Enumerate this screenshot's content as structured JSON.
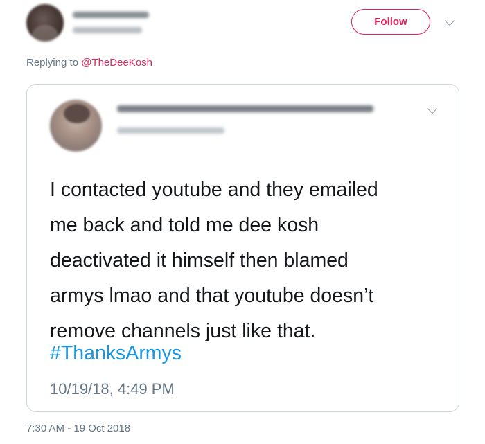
{
  "outer_tweet": {
    "follow_label": "Follow",
    "replying_prefix": "Replying to",
    "replying_mention": "@TheDeeKosh",
    "timestamp": "7:30 AM - 19 Oct 2018"
  },
  "quoted_tweet": {
    "text_lines": [
      "I contacted youtube and they emailed",
      "me back and told me dee kosh",
      "deactivated it himself then blamed",
      "armys lmao and that youtube doesn’t",
      "remove channels just like that."
    ],
    "hashtag": "#ThanksArmys",
    "timestamp": "10/19/18, 4:49 PM"
  },
  "colors": {
    "accent": "#e0245e",
    "link": "#1b95e0",
    "muted": "#657786",
    "border": "#ccd6dd"
  },
  "icons": {
    "more": "chevron-down-icon"
  }
}
